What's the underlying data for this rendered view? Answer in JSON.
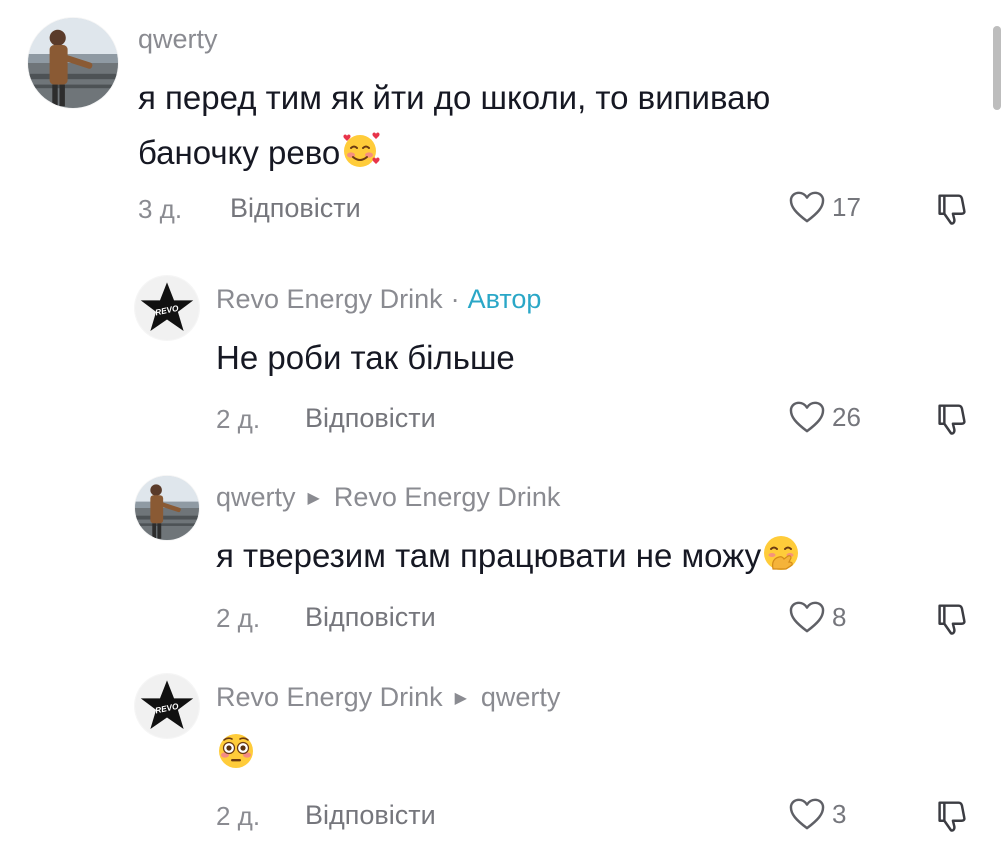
{
  "comments": [
    {
      "username": "qwerty",
      "text_line1": "я перед тим як йти до школи, то випиваю",
      "text_line2": "баночку рево",
      "emoji": "smiling-face-with-hearts",
      "time": "3 д.",
      "reply_label": "Відповісти",
      "likes": "17"
    },
    {
      "username": "Revo Energy Drink",
      "separator": "·",
      "author_badge": "Автор",
      "text": "Не роби так більше",
      "time": "2 д.",
      "reply_label": "Відповісти",
      "likes": "26"
    },
    {
      "username": "qwerty",
      "reply_to": "Revo Energy Drink",
      "text": "я тверезим там працювати не можу",
      "emoji": "face-with-hand-over-mouth",
      "time": "2 д.",
      "reply_label": "Відповісти",
      "likes": "8"
    },
    {
      "username": "Revo Energy Drink",
      "reply_to": "qwerty",
      "text": "",
      "emoji": "flushed-face",
      "time": "2 д.",
      "reply_label": "Відповісти",
      "likes": "3"
    }
  ],
  "avatar_logo_text": "REVO",
  "icons": {
    "like": "heart-outline-icon",
    "dislike": "thumbs-down-icon",
    "reply_arrow": "triangle-right-icon"
  },
  "colors": {
    "text": "#161823",
    "muted": "#8a8b91",
    "author": "#2aa7c7"
  }
}
